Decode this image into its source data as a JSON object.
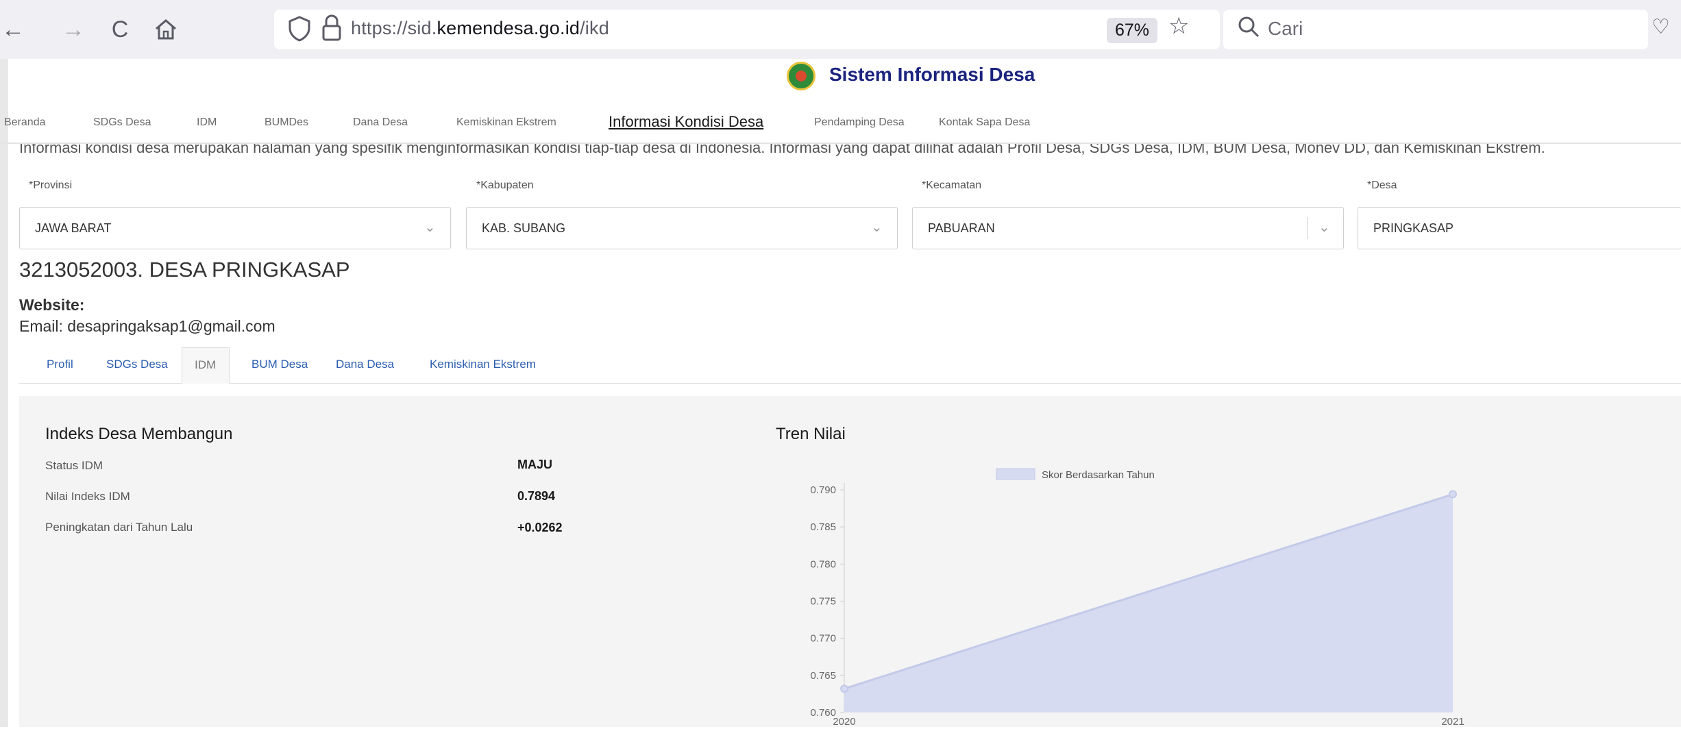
{
  "browser": {
    "url_prefix": "https://sid.",
    "url_domain": "kemendesa.go.id",
    "url_path": "/ikd",
    "zoom": "67%",
    "search_placeholder": "Cari"
  },
  "site": {
    "title": "Sistem Informasi Desa"
  },
  "nav": [
    {
      "label": "Beranda"
    },
    {
      "label": "SDGs Desa"
    },
    {
      "label": "IDM"
    },
    {
      "label": "BUMDes"
    },
    {
      "label": "Dana Desa"
    },
    {
      "label": "Kemiskinan Ekstrem"
    },
    {
      "label": "Informasi Kondisi Desa",
      "active": true
    },
    {
      "label": "Pendamping Desa"
    },
    {
      "label": "Kontak Sapa Desa"
    }
  ],
  "intro_text": "Informasi kondisi desa merupakan halaman yang spesifik menginformasikan kondisi tiap-tiap desa di Indonesia. Informasi yang dapat dilihat adalah Profil Desa, SDGs Desa, IDM, BUM Desa, Monev DD, dan Kemiskinan Ekstrem.",
  "filters": [
    {
      "label": "*Provinsi",
      "value": "JAWA BARAT"
    },
    {
      "label": "*Kabupaten",
      "value": "KAB. SUBANG"
    },
    {
      "label": "*Kecamatan",
      "value": "PABUARAN"
    },
    {
      "label": "*Desa",
      "value": "PRINGKASAP"
    }
  ],
  "village": {
    "title": "3213052003. DESA PRINGKASAP",
    "website": "Website:",
    "email": "Email: desapringaksap1@gmail.com"
  },
  "tabs": [
    {
      "label": "Profil"
    },
    {
      "label": "SDGs Desa"
    },
    {
      "label": "IDM",
      "active": true
    },
    {
      "label": "BUM Desa"
    },
    {
      "label": "Dana Desa"
    },
    {
      "label": "Kemiskinan Ekstrem"
    }
  ],
  "idm": {
    "title": "Indeks Desa Membangun",
    "rows": [
      {
        "label": "Status IDM",
        "value": "MAJU"
      },
      {
        "label": "Nilai Indeks IDM",
        "value": "0.7894"
      },
      {
        "label": "Peningkatan dari Tahun Lalu",
        "value": "+0.0262"
      }
    ]
  },
  "trend": {
    "title": "Tren Nilai"
  },
  "chart_data": {
    "type": "area",
    "x": [
      "2020",
      "2021"
    ],
    "series": [
      {
        "name": "Skor Berdasarkan Tahun",
        "values": [
          0.7632,
          0.7894
        ]
      }
    ],
    "yticks": [
      "0.790",
      "0.785",
      "0.780",
      "0.775",
      "0.770",
      "0.765",
      "0.760"
    ],
    "ylim": [
      0.76,
      0.79
    ],
    "legend": "top",
    "fill_color": "#d6dbf1",
    "line_color": "#c3cae9"
  }
}
